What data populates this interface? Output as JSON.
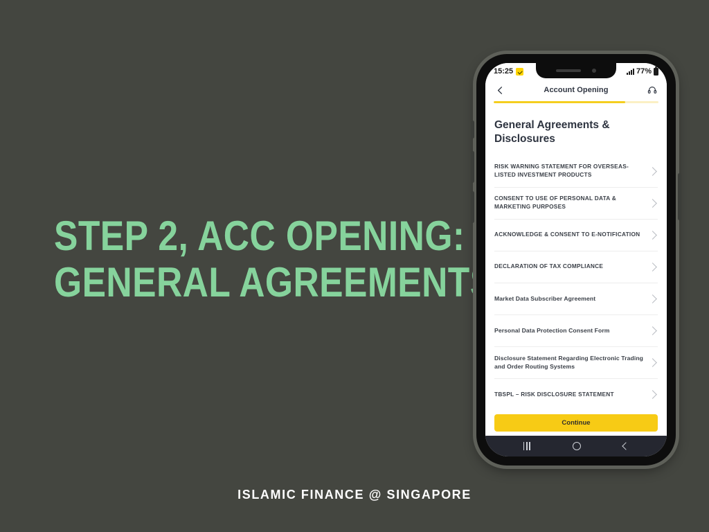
{
  "slide": {
    "title_line1": "STEP 2, ACC OPENING:",
    "title_line2": "GENERAL AGREEMENTS",
    "footer": "ISLAMIC FINANCE @ SINGAPORE",
    "background_color": "#444640",
    "title_color": "#86D39C",
    "footer_color": "#FFFFFF"
  },
  "phone": {
    "status_bar": {
      "time": "15:25",
      "badge_icon": "check-badge-icon",
      "signal_icon": "signal-bars-icon",
      "battery_percent": "77%",
      "battery_icon": "battery-icon"
    },
    "header": {
      "back_icon": "chevron-left-icon",
      "title": "Account Opening",
      "support_icon": "headset-icon",
      "progress_percent": 80,
      "progress_fill_color": "#F5CE1E",
      "progress_track_color": "#FBF0C4"
    },
    "page_heading": "General Agreements & Disclosures",
    "agreements": [
      {
        "label": "RISK WARNING STATEMENT FOR OVERSEAS-LISTED INVESTMENT PRODUCTS",
        "style": "caps"
      },
      {
        "label": "CONSENT TO USE OF PERSONAL DATA & MARKETING PURPOSES",
        "style": "caps"
      },
      {
        "label": "ACKNOWLEDGE & CONSENT TO E-NOTIFICATION",
        "style": "caps"
      },
      {
        "label": "DECLARATION OF TAX COMPLIANCE",
        "style": "caps"
      },
      {
        "label": "Market Data Subscriber Agreement",
        "style": "mixed"
      },
      {
        "label": "Personal Data Protection Consent Form",
        "style": "mixed"
      },
      {
        "label": "Disclosure Statement Regarding Electronic Trading and Order Routing Systems",
        "style": "mixed"
      },
      {
        "label": "TBSPL – RISK DISCLOSURE STATEMENT",
        "style": "caps"
      }
    ],
    "cta": {
      "label": "Continue",
      "color": "#F7CB15"
    },
    "nav_bar": {
      "recents_icon": "recents-icon",
      "home_icon": "home-icon",
      "back_icon": "back-icon",
      "background_color": "#252730"
    }
  }
}
